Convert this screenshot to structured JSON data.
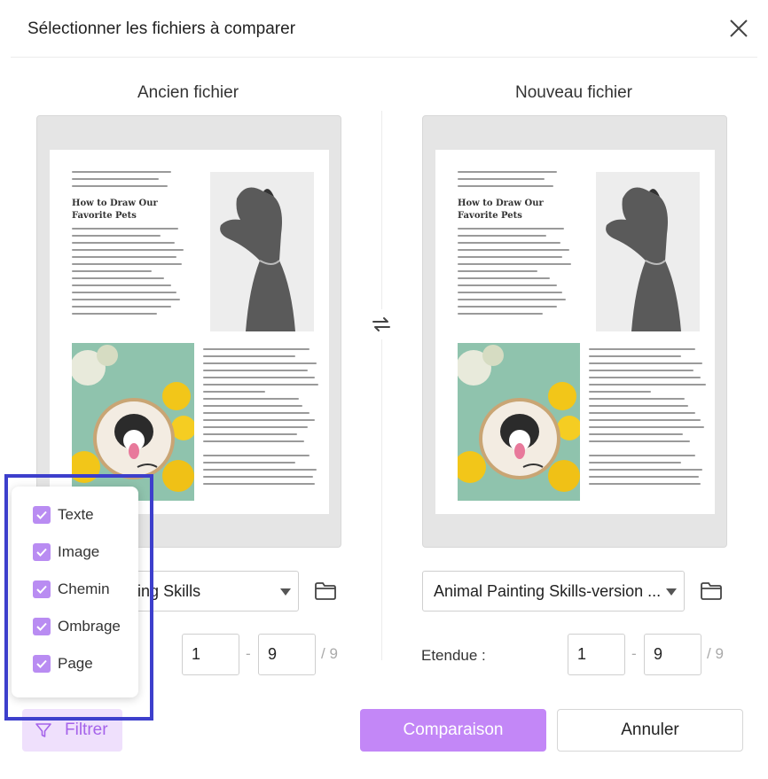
{
  "dialog": {
    "title": "Sélectionner les fichiers à comparer"
  },
  "old_file": {
    "heading": "Ancien fichier",
    "select_value": "Animal Painting Skills",
    "range_from": "1",
    "range_to": "9",
    "range_total": "/ 9",
    "doc_heading_line1": "How to Draw Our",
    "doc_heading_line2": "Favorite Pets"
  },
  "new_file": {
    "heading": "Nouveau fichier",
    "select_value": "Animal Painting Skills-version ...",
    "range_label": "Etendue :",
    "range_from": "1",
    "range_to": "9",
    "range_total": "/ 9",
    "doc_heading_line1": "How to Draw Our",
    "doc_heading_line2": "Favorite Pets"
  },
  "range_dash": "-",
  "filter_menu": {
    "options": [
      {
        "label": "Texte",
        "checked": true
      },
      {
        "label": "Image",
        "checked": true
      },
      {
        "label": "Chemin",
        "checked": true
      },
      {
        "label": "Ombrage",
        "checked": true
      },
      {
        "label": "Page",
        "checked": true
      }
    ]
  },
  "buttons": {
    "filter": "Filtrer",
    "compare": "Comparaison",
    "cancel": "Annuler"
  },
  "colors": {
    "accent": "#c387f7",
    "checkbox": "#b98cf2",
    "highlight_border": "#3d3fcc",
    "filter_bg": "#efe0fc"
  },
  "icons": [
    "close-icon",
    "swap-icon",
    "folder-icon",
    "filter-icon",
    "caret-down-icon",
    "check-icon"
  ]
}
